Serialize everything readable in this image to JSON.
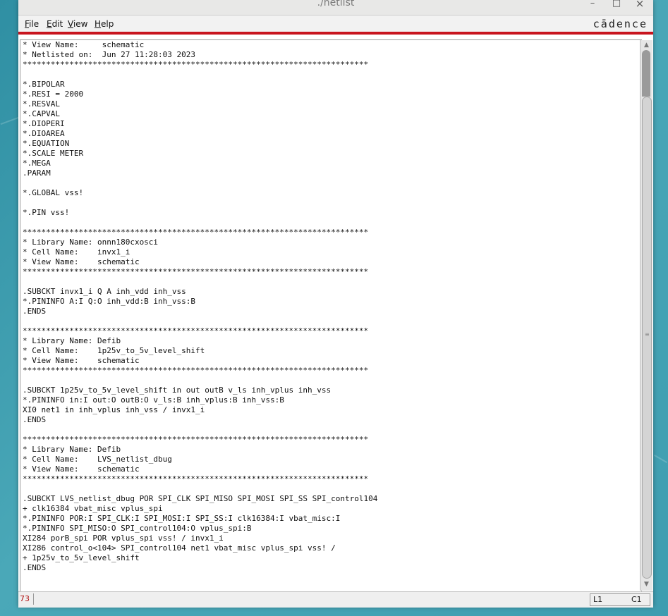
{
  "window": {
    "title": "./netlist",
    "minimize_glyph": "–",
    "maximize_glyph": "□",
    "close_glyph": "×"
  },
  "menubar": {
    "items": [
      {
        "label_underlined": "F",
        "label_rest": "ile"
      },
      {
        "label_underlined": "E",
        "label_rest": "dit"
      },
      {
        "label_underlined": "V",
        "label_rest": "iew"
      },
      {
        "label_underlined": "H",
        "label_rest": "elp"
      }
    ],
    "brand": "cādence"
  },
  "editor": {
    "lines": [
      "* View Name:     schematic",
      "* Netlisted on:  Jun 27 11:28:03 2023",
      "**************************************************************************",
      "",
      "*.BIPOLAR",
      "*.RESI = 2000",
      "*.RESVAL",
      "*.CAPVAL",
      "*.DIOPERI",
      "*.DIOAREA",
      "*.EQUATION",
      "*.SCALE METER",
      "*.MEGA",
      ".PARAM",
      "",
      "*.GLOBAL vss!",
      "",
      "*.PIN vss!",
      "",
      "**************************************************************************",
      "* Library Name: onnn180cxosci",
      "* Cell Name:    invx1_i",
      "* View Name:    schematic",
      "**************************************************************************",
      "",
      ".SUBCKT invx1_i Q A inh_vdd inh_vss",
      "*.PININFO A:I Q:O inh_vdd:B inh_vss:B",
      ".ENDS",
      "",
      "**************************************************************************",
      "* Library Name: Defib",
      "* Cell Name:    1p25v_to_5v_level_shift",
      "* View Name:    schematic",
      "**************************************************************************",
      "",
      ".SUBCKT 1p25v_to_5v_level_shift in out outB v_ls inh_vplus inh_vss",
      "*.PININFO in:I out:O outB:O v_ls:B inh_vplus:B inh_vss:B",
      "XI0 net1 in inh_vplus inh_vss / invx1_i",
      ".ENDS",
      "",
      "**************************************************************************",
      "* Library Name: Defib",
      "* Cell Name:    LVS_netlist_dbug",
      "* View Name:    schematic",
      "**************************************************************************",
      "",
      ".SUBCKT LVS_netlist_dbug POR SPI_CLK SPI_MISO SPI_MOSI SPI_SS SPI_control104",
      "+ clk16384 vbat_misc vplus_spi",
      "*.PININFO POR:I SPI_CLK:I SPI_MOSI:I SPI_SS:I clk16384:I vbat_misc:I",
      "*.PININFO SPI_MISO:O SPI_control104:O vplus_spi:B",
      "XI284 porB_spi POR vplus_spi vss! / invx1_i",
      "XI286 control_o<104> SPI_control104 net1 vbat_misc vplus_spi vss! /",
      "+ 1p25v_to_5v_level_shift",
      ".ENDS"
    ]
  },
  "scrollbar": {
    "up_glyph": "▲",
    "down_glyph": "▼"
  },
  "status": {
    "line_count": "73",
    "line": "L1",
    "column": "C1"
  },
  "colors": {
    "accent": "#c8141e",
    "desktop": "#3e9db0"
  }
}
